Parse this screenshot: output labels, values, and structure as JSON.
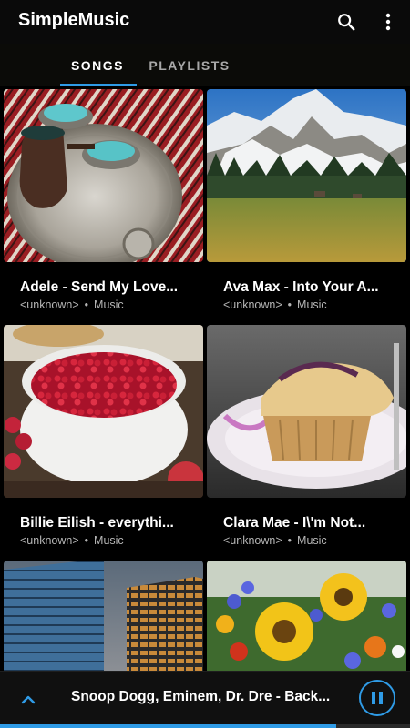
{
  "app": {
    "title": "SimpleMusic"
  },
  "toolbar": {
    "search_icon": "search-icon",
    "menu_icon": "more-vert-icon"
  },
  "tabs": [
    {
      "label": "SONGS",
      "selected": true
    },
    {
      "label": "PLAYLISTS",
      "selected": false
    }
  ],
  "songs": [
    {
      "title": "Adele - Send My Love...",
      "artist": "<unknown>",
      "separator": "•",
      "album": "Music",
      "art": "turkish-coffee-artwork"
    },
    {
      "title": "Ava Max - Into Your A...",
      "artist": "<unknown>",
      "separator": "•",
      "album": "Music",
      "art": "mountain-meadow-artwork"
    },
    {
      "title": "Billie Eilish - everythi...",
      "artist": "<unknown>",
      "separator": "•",
      "album": "Music",
      "art": "raspberries-artwork"
    },
    {
      "title": "Clara Mae - I\\'m Not...",
      "artist": "<unknown>",
      "separator": "•",
      "album": "Music",
      "art": "muffin-artwork"
    },
    {
      "title": "",
      "artist": "",
      "separator": "",
      "album": "",
      "art": "buildings-artwork"
    },
    {
      "title": "",
      "artist": "",
      "separator": "",
      "album": "",
      "art": "flowers-artwork"
    }
  ],
  "now_playing": {
    "title": "Snoop Dogg, Eminem, Dr. Dre - Back...",
    "progress": 0.82,
    "state": "playing",
    "accent": "#2f9be6"
  }
}
